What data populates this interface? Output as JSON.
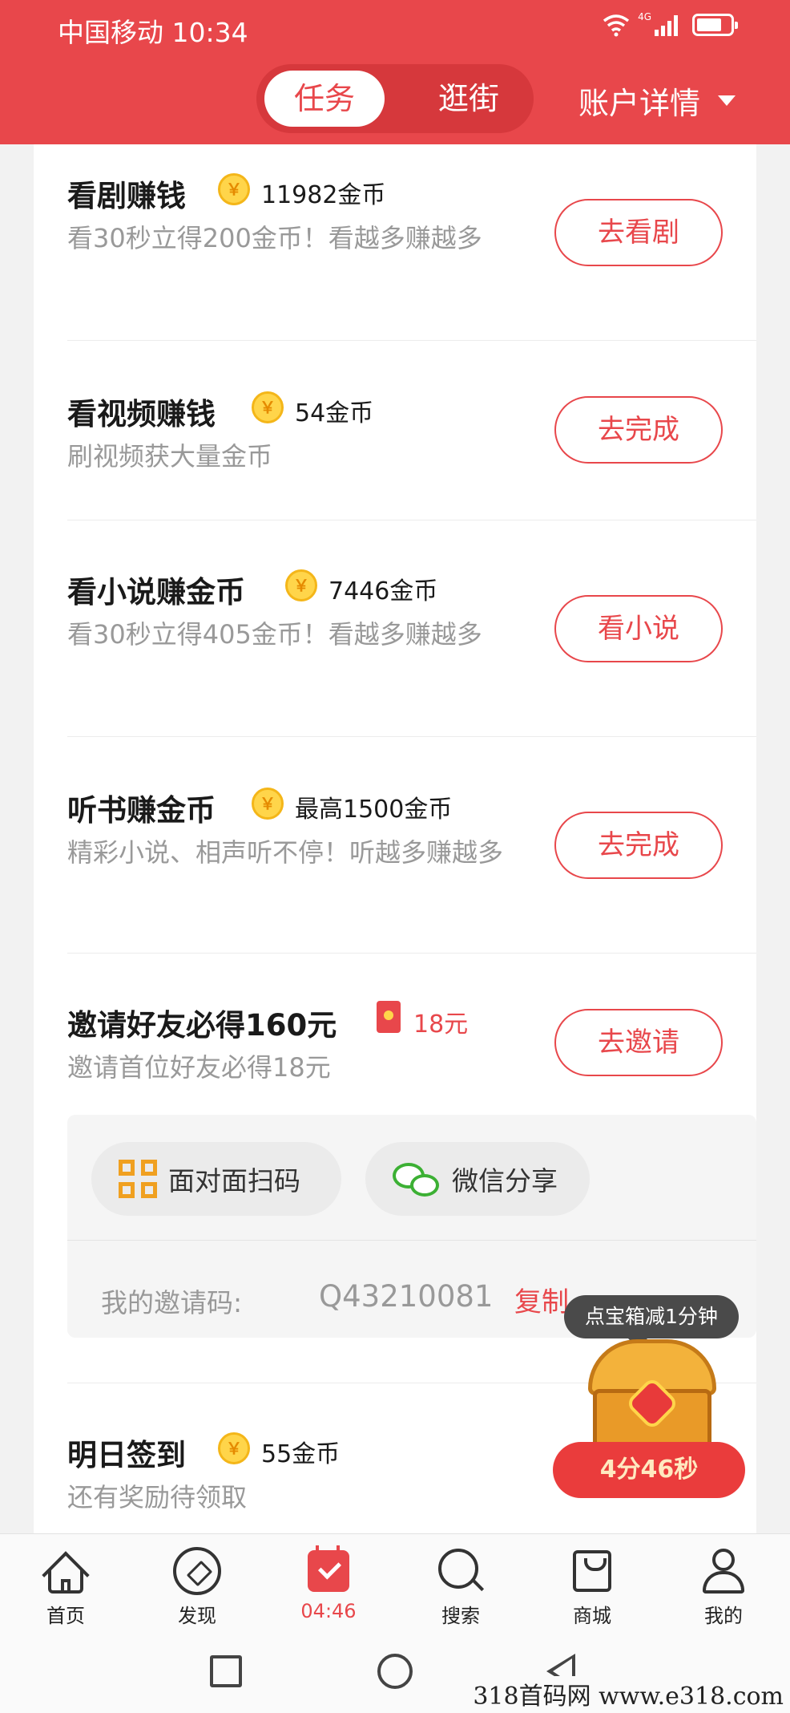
{
  "status_bar": {
    "carrier_time": "中国移动 10:34",
    "network": "4G"
  },
  "header": {
    "tabs": [
      "任务",
      "逛街"
    ],
    "account_label": "账户详情"
  },
  "tasks": [
    {
      "title": "看剧赚钱",
      "reward": "11982金币",
      "desc": "看30秒立得200金币！看越多赚越多",
      "button": "去看剧"
    },
    {
      "title": "看视频赚钱",
      "reward": "54金币",
      "desc": "刷视频获大量金币",
      "button": "去完成"
    },
    {
      "title": "看小说赚金币",
      "reward": "7446金币",
      "desc": "看30秒立得405金币！看越多赚越多",
      "button": "看小说"
    },
    {
      "title": "听书赚金币",
      "reward": "最高1500金币",
      "desc": "精彩小说、相声听不停！听越多赚越多",
      "button": "去完成"
    },
    {
      "title": "邀请好友必得160元",
      "reward": "18元",
      "desc": "邀请首位好友必得18元",
      "button": "去邀请"
    },
    {
      "title": "明日签到",
      "reward": "55金币",
      "desc": "还有奖励待领取",
      "button": ""
    }
  ],
  "invite_panel": {
    "qr_label": "面对面扫码",
    "wechat_label": "微信分享",
    "code_label": "我的邀请码:",
    "code_value": "Q43210081",
    "copy_label": "复制"
  },
  "treasure": {
    "tip": "点宝箱减1分钟",
    "timer": "4分46秒"
  },
  "coin_glyph": "￥",
  "bottom_nav": [
    {
      "label": "首页",
      "icon": "home-icon"
    },
    {
      "label": "发现",
      "icon": "compass-icon"
    },
    {
      "label": "04:46",
      "icon": "calendar-check-icon",
      "active": true
    },
    {
      "label": "搜索",
      "icon": "search-icon"
    },
    {
      "label": "商城",
      "icon": "shopping-bag-icon"
    },
    {
      "label": "我的",
      "icon": "user-icon"
    }
  ],
  "watermark": "318首码网 www.e318.com",
  "colors": {
    "accent": "#e8474b",
    "coin": "#ffd54a"
  }
}
